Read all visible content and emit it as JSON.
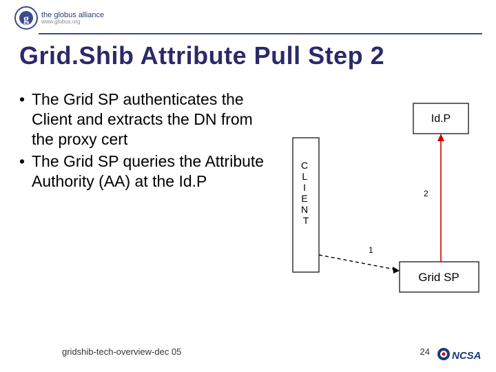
{
  "logo": {
    "top": "the globus alliance",
    "sub": "www.globus.org"
  },
  "title": "Grid.Shib Attribute Pull Step 2",
  "bullets": [
    "The Grid SP authenticates the Client and extracts the DN from the proxy cert",
    "The Grid SP queries the Attribute Authority (AA) at the Id.P"
  ],
  "diagram": {
    "idp": "Id.P",
    "client": "CLIENT",
    "gridsp": "Grid SP",
    "label1": "1",
    "label2": "2"
  },
  "footer": {
    "left": "gridshib-tech-overview-dec 05",
    "pagenum": "24",
    "ncsa": "NCSA"
  }
}
